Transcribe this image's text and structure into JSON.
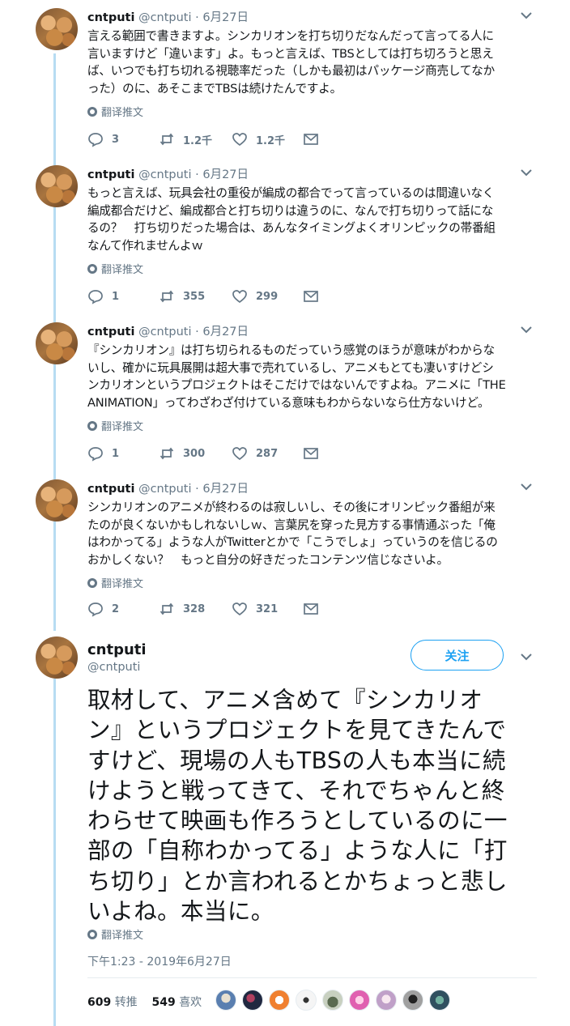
{
  "thread": [
    {
      "name": "cntputi",
      "handle": "@cntputi",
      "date": "6月27日",
      "text": "言える範囲で書きますよ。シンカリオンを打ち切りだなんだって言ってる人に\n言いますけど「違います」よ。もっと言えば、TBSとしては打ち切ろうと思え\nば、いつでも打ち切れる視聴率だった（しかも最初はパッケージ商売してなか\nった）のに、あそこまでTBSは続けたんですよ。",
      "translate": "翻译推文",
      "replies": "3",
      "retweets": "1.2千",
      "likes": "1.2千"
    },
    {
      "name": "cntputi",
      "handle": "@cntputi",
      "date": "6月27日",
      "text": "もっと言えば、玩具会社の重役が編成の都合でって言っているのは間違いなく\n編成都合だけど、編成都合と打ち切りは違うのに、なんで打ち切りって話にな\nるの？　打ち切りだった場合は、あんなタイミングよくオリンピックの帯番組\nなんて作れませんよｗ",
      "translate": "翻译推文",
      "replies": "1",
      "retweets": "355",
      "likes": "299"
    },
    {
      "name": "cntputi",
      "handle": "@cntputi",
      "date": "6月27日",
      "text": "『シンカリオン』は打ち切られるものだっていう感覚のほうが意味がわからな\nいし、確かに玩具展開は超大事で売れているし、アニメもとても凄いすけどシ\nンカリオンというプロジェクトはそこだけではないんですよね。アニメに「THE\nANIMATION」ってわざわざ付けている意味もわからないなら仕方ないけど。",
      "translate": "翻译推文",
      "replies": "1",
      "retweets": "300",
      "likes": "287"
    },
    {
      "name": "cntputi",
      "handle": "@cntputi",
      "date": "6月27日",
      "text": "シンカリオンのアニメが終わるのは寂しいし、その後にオリンピック番組が来\nたのが良くないかもしれないしｗ、言葉尻を穿った見方する事情通ぶった「俺\nはわかってる」ような人がTwitterとかで「こうでしょ」っていうのを信じるの\nおかしくない？　もっと自分の好きだったコンテンツ信じなさいよ。",
      "translate": "翻译推文",
      "replies": "2",
      "retweets": "328",
      "likes": "321"
    }
  ],
  "main": {
    "name": "cntputi",
    "handle": "@cntputi",
    "follow_label": "关注",
    "text": "取材して、アニメ含めて『シンカリオ\nン』というプロジェクトを見てきたんで\nすけど、現場の人もTBSの人も本当に続\nけようと戦ってきて、それでちゃんと終\nわらせて映画も作ろうとしているのに一\n部の「自称わかってる」ような人に「打\nち切り」とか言われるとかちょっと悲し\nいよね。本当に。",
    "translate": "翻译推文",
    "timestamp": "下午1:23 - 2019年6月27日",
    "retweet_count": "609",
    "retweet_label": "转推",
    "like_count": "549",
    "like_label": "喜欢"
  },
  "colors": {
    "accent": "#1da1f2",
    "muted": "#657786",
    "thread_line": "#b7dcf2"
  },
  "icons": [
    "reply-icon",
    "retweet-icon",
    "like-icon",
    "dm-icon",
    "chevron-down-icon",
    "globe-icon"
  ]
}
